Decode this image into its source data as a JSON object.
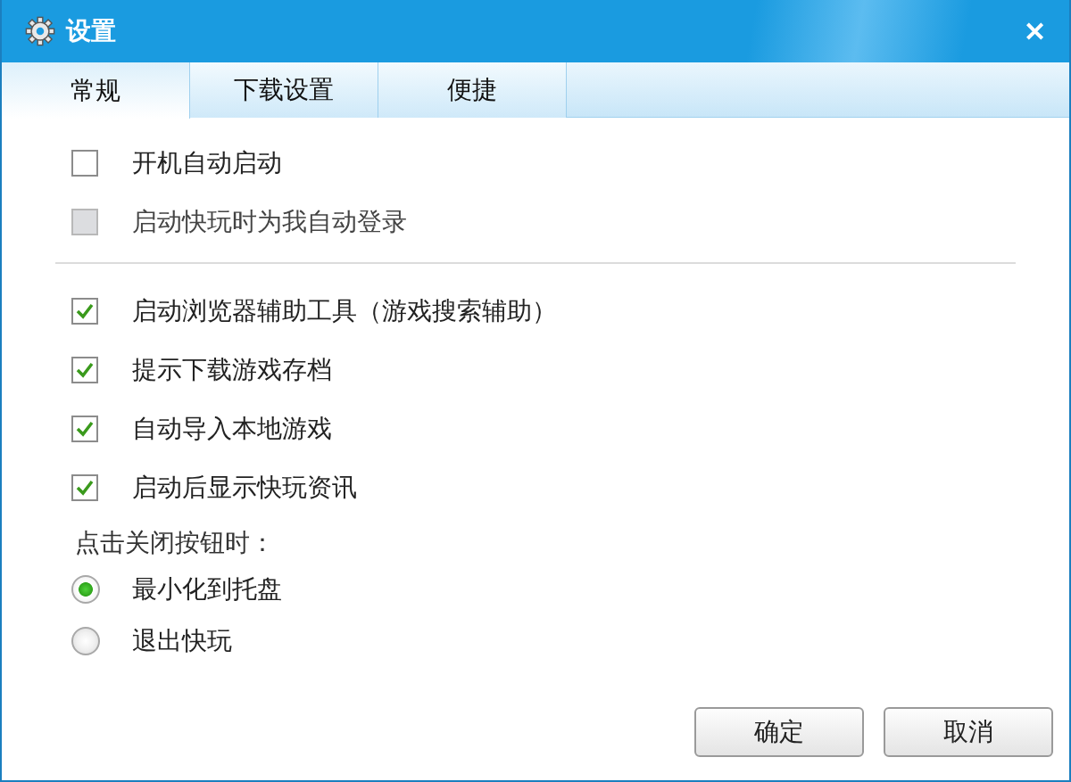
{
  "window": {
    "title": "设置",
    "close": "✕"
  },
  "tabs": [
    {
      "label": "常规",
      "selected": true
    },
    {
      "label": "下载设置",
      "selected": false
    },
    {
      "label": "便捷",
      "selected": false
    }
  ],
  "checkbox_groups": [
    [
      {
        "label": "开机自动启动",
        "checked": false,
        "disabled": false
      },
      {
        "label": "启动快玩时为我自动登录",
        "checked": false,
        "disabled": true
      }
    ],
    [
      {
        "label": "启动浏览器辅助工具（游戏搜索辅助）",
        "checked": true,
        "disabled": false
      },
      {
        "label": "提示下载游戏存档",
        "checked": true,
        "disabled": false
      },
      {
        "label": "自动导入本地游戏",
        "checked": true,
        "disabled": false
      },
      {
        "label": "启动后显示快玩资讯",
        "checked": true,
        "disabled": false
      }
    ]
  ],
  "close_action": {
    "label": "点击关闭按钮时：",
    "options": [
      {
        "label": "最小化到托盘",
        "selected": true
      },
      {
        "label": "退出快玩",
        "selected": false
      }
    ]
  },
  "buttons": [
    "确定",
    "取消"
  ]
}
